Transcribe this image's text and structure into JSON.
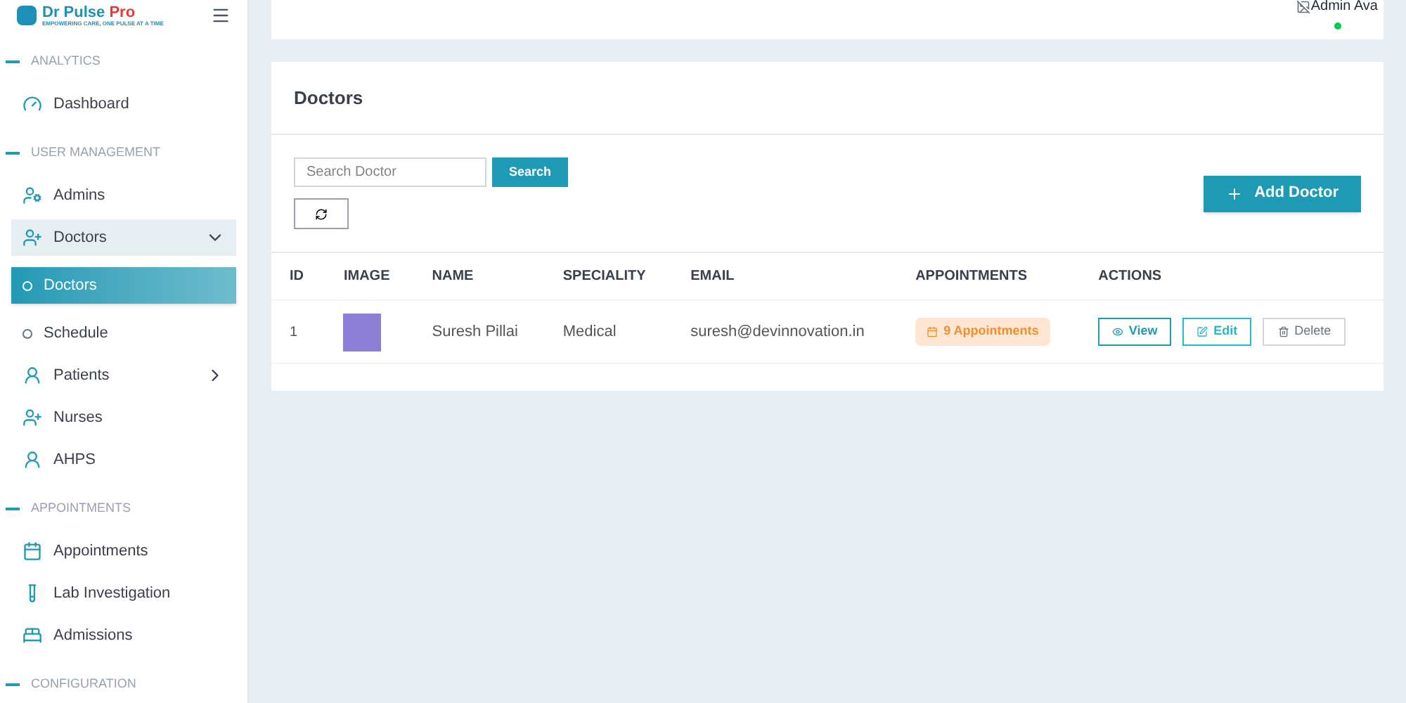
{
  "logo": {
    "name": "Dr Pulse",
    "accent": "Pro",
    "tagline": "EMPOWERING CARE, ONE PULSE AT A TIME"
  },
  "sidebar": {
    "sections": [
      {
        "title": "ANALYTICS",
        "items": [
          {
            "label": "Dashboard",
            "selected": false
          }
        ]
      },
      {
        "title": "USER MANAGEMENT",
        "items": [
          {
            "label": "Admins",
            "selected": false
          },
          {
            "label": "Doctors",
            "selected": false,
            "expanded": true,
            "children": [
              {
                "label": "Doctors",
                "selected": true
              },
              {
                "label": "Schedule",
                "selected": false
              }
            ]
          },
          {
            "label": "Patients",
            "selected": false,
            "expanded": false
          },
          {
            "label": "Nurses",
            "selected": false
          },
          {
            "label": "AHPS",
            "selected": false
          }
        ]
      },
      {
        "title": "APPOINTMENTS",
        "items": [
          {
            "label": "Appointments",
            "selected": false
          },
          {
            "label": "Lab Investigation",
            "selected": false
          },
          {
            "label": "Admissions",
            "selected": false
          }
        ]
      },
      {
        "title": "CONFIGURATION"
      }
    ]
  },
  "header": {
    "avatar_alt": "Admin Ava",
    "online": true
  },
  "panel": {
    "title": "Doctors",
    "search": {
      "placeholder": "Search Doctor",
      "button": "Search"
    },
    "add_button": "Add Doctor",
    "table": {
      "columns": [
        "ID",
        "IMAGE",
        "NAME",
        "SPECIALITY",
        "EMAIL",
        "APPOINTMENTS",
        "ACTIONS"
      ],
      "rows": [
        {
          "id": "1",
          "name": "Suresh Pillai",
          "speciality": "Medical",
          "email": "suresh@devinnovation.in",
          "appointments": "9 Appointments",
          "view": "View",
          "edit": "Edit",
          "delete": "Delete",
          "delete_disabled": true
        }
      ]
    }
  }
}
